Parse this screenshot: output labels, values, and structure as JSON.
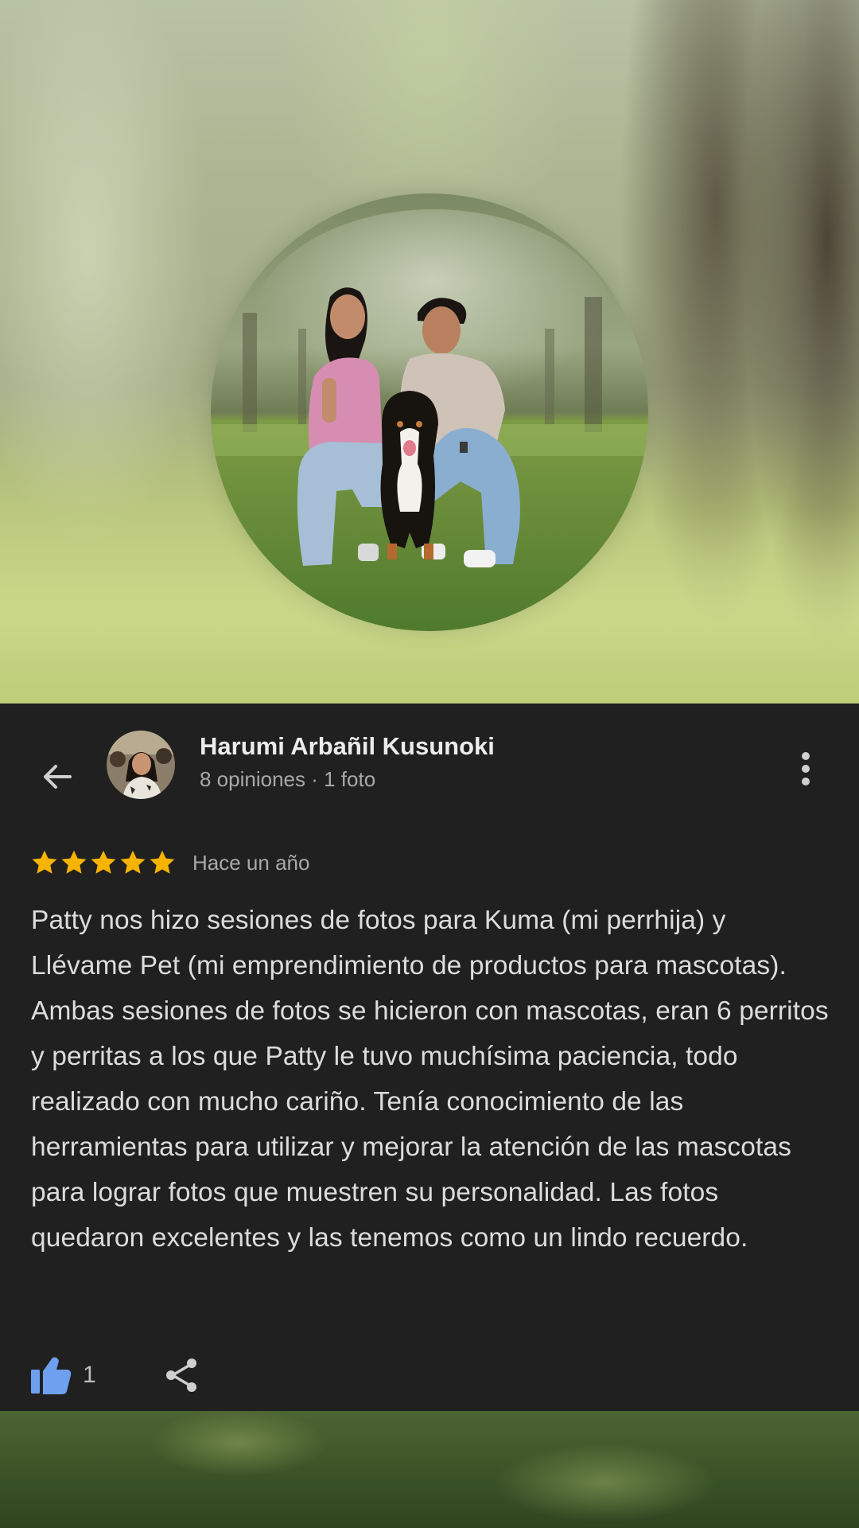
{
  "header": {
    "back_icon": "arrow-back-icon",
    "more_icon": "more-vert-icon"
  },
  "reviewer": {
    "name": "Harumi Arbañil Kusunoki",
    "meta": "8 opiniones · 1 foto",
    "avatar_icon": "avatar-photo"
  },
  "review": {
    "rating": 5,
    "rating_max": 5,
    "date": "Hace un año",
    "text": "Patty nos hizo sesiones de fotos para Kuma (mi perrhija) y Llévame Pet (mi emprendimiento de productos para mascotas). Ambas sesiones de fotos se hicieron con mascotas, eran 6 perritos y perritas a los que Patty le tuvo muchísima paciencia, todo realizado con mucho cariño. Tenía conocimiento de las herramientas para utilizar y mejorar la atención de las mascotas para lograr fotos que muestren su personalidad. Las fotos quedaron excelentes y las tenemos como un lindo recuerdo."
  },
  "actions": {
    "like_count": "1",
    "like_icon": "thumbs-up-icon",
    "share_icon": "share-icon"
  },
  "colors": {
    "card_background": "#202020",
    "star": "#f6b400",
    "like_blue": "#6ea0f0",
    "primary_text": "#ececec",
    "secondary_text": "#a9a9a9"
  }
}
